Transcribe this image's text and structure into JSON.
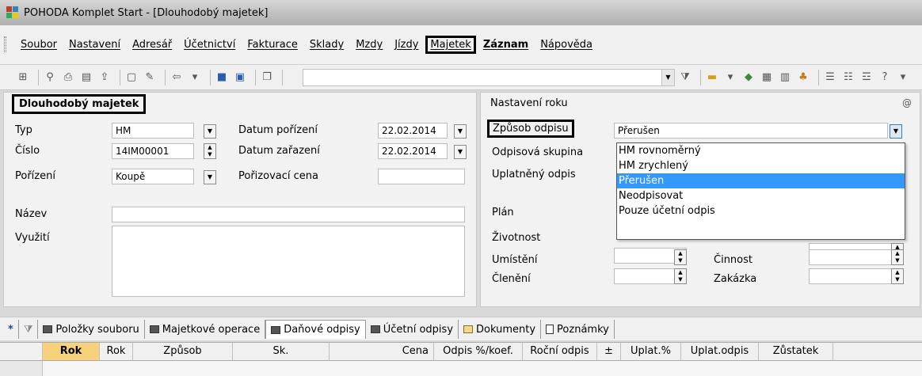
{
  "window": {
    "title": "POHODA Komplet Start - [Dlouhodobý majetek]"
  },
  "menu": {
    "items": [
      "Soubor",
      "Nastavení",
      "Adresář",
      "Účetnictví",
      "Fakturace",
      "Sklady",
      "Mzdy",
      "Jízdy",
      "Majetek",
      "Záznam",
      "Nápověda"
    ]
  },
  "left_panel": {
    "title": "Dlouhodobý majetek",
    "typ_label": "Typ",
    "typ_value": "HM",
    "cislo_label": "Číslo",
    "cislo_value": "14IM00001",
    "porizeni_label": "Pořízení",
    "porizeni_value": "Koupě",
    "datum_porizeni_label": "Datum pořízení",
    "datum_porizeni_value": "22.02.2014",
    "datum_zarazeni_label": "Datum zařazení",
    "datum_zarazeni_value": "22.02.2014",
    "porizovaci_cena_label": "Pořizovací cena",
    "porizovaci_cena_value": "",
    "nazev_label": "Název",
    "nazev_value": "",
    "vyuziti_label": "Využití",
    "vyuziti_value": ""
  },
  "right_panel": {
    "title": "Nastavení roku",
    "at_symbol": "@",
    "zpusob_odpisu_label": "Způsob odpisu",
    "zpusob_odpisu_value": "Přerušen",
    "odpisova_skupina_label": "Odpisová skupina",
    "uplatneny_odpis_label": "Uplatněný odpis",
    "plan_label": "Plán",
    "zivotnost_label": "Životnost",
    "umisteni_label": "Umístění",
    "cleneni_label": "Členění",
    "cinnost_label": "Činnost",
    "zakazka_label": "Zakázka"
  },
  "dropdown": {
    "options": [
      "HM rovnoměrný",
      "HM zrychlený",
      "Přerušen",
      "Neodpisovat",
      "Pouze účetní odpis"
    ],
    "selected_index": 2
  },
  "tabs": {
    "star": "*",
    "items": [
      "Položky souboru",
      "Majetkové operace",
      "Daňové odpisy",
      "Účetní odpisy",
      "Dokumenty",
      "Poznámky"
    ],
    "active_index": 2
  },
  "grid": {
    "columns": [
      "Rok",
      "Rok",
      "Způsob",
      "Sk.",
      "Cena",
      "Odpis %/koef.",
      "Roční odpis",
      "±",
      "Uplat.%",
      "Uplat.odpis",
      "Zůstatek"
    ],
    "highlight_color": "#f7d27a"
  },
  "colors": {
    "selection": "#3399ff"
  }
}
